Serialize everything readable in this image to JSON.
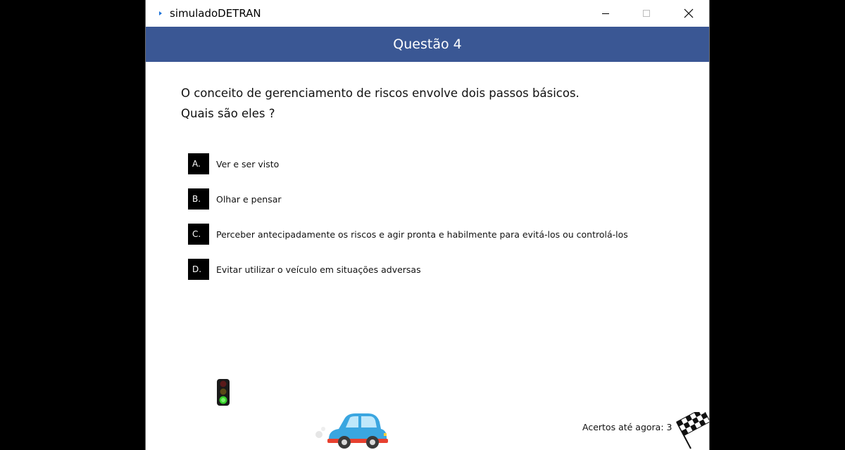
{
  "window": {
    "title": "simuladoDETRAN"
  },
  "question": {
    "header": "Questão 4",
    "text_line1": "O conceito de gerenciamento de riscos envolve dois passos básicos.",
    "text_line2": "Quais são eles ?"
  },
  "options": [
    {
      "letter": "A.",
      "text": "Ver e ser visto"
    },
    {
      "letter": "B.",
      "text": "Olhar e pensar"
    },
    {
      "letter": "C.",
      "text": "Perceber antecipadamente os riscos e agir pronta e habilmente para evitá-los ou controlá-los"
    },
    {
      "letter": "D.",
      "text": "Evitar utilizar o veículo em situações adversas"
    }
  ],
  "score": {
    "label": "Acertos até agora: 3"
  },
  "icons": {
    "app": "app-icon",
    "minimize": "minimize-icon",
    "maximize": "maximize-icon",
    "close": "close-icon",
    "traffic_light": "traffic-light-icon",
    "car": "car-icon",
    "finish_flag": "checkered-flag-icon"
  },
  "colors": {
    "header_bg": "#3a5794",
    "option_letter_bg": "#000000",
    "traffic_light_active": "#35d12a",
    "car_body": "#3aa6e0"
  }
}
